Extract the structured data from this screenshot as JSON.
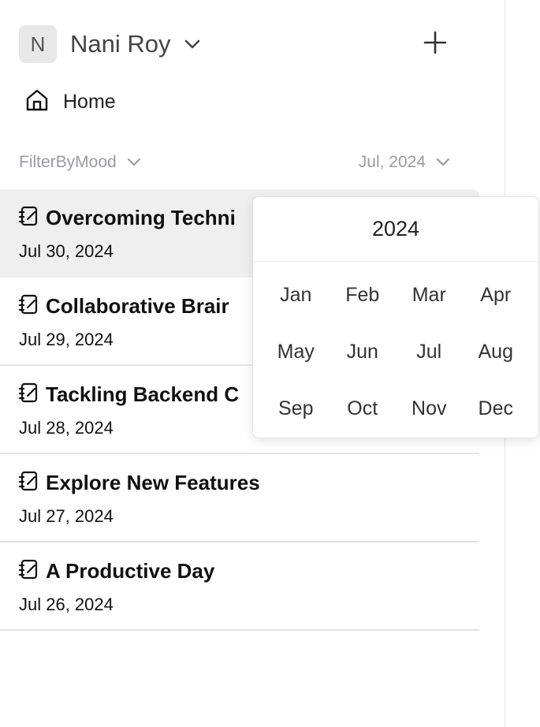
{
  "account": {
    "initial": "N",
    "name": "Nani Roy",
    "caret_icon": "chevron-down-icon",
    "add_icon": "plus-icon"
  },
  "nav": {
    "home_label": "Home",
    "home_icon": "home-icon"
  },
  "filters": {
    "mood_label": "FilterByMood",
    "month_label": "Jul, 2024"
  },
  "entries": [
    {
      "title": "Overcoming Techni",
      "date": "Jul 30, 2024",
      "selected": true
    },
    {
      "title": "Collaborative Brair",
      "date": "Jul 29, 2024"
    },
    {
      "title": "Tackling Backend C",
      "date": "Jul 28, 2024"
    },
    {
      "title": "Explore New Features",
      "date": "Jul 27, 2024"
    },
    {
      "title": "A Productive Day",
      "date": "Jul 26, 2024"
    }
  ],
  "month_picker": {
    "year": "2024",
    "months": [
      "Jan",
      "Feb",
      "Mar",
      "Apr",
      "May",
      "Jun",
      "Jul",
      "Aug",
      "Sep",
      "Oct",
      "Nov",
      "Dec"
    ]
  },
  "colors": {
    "muted": "#9a9aa6",
    "selected_row": "#efefef",
    "divider": "#e4e4e4"
  }
}
